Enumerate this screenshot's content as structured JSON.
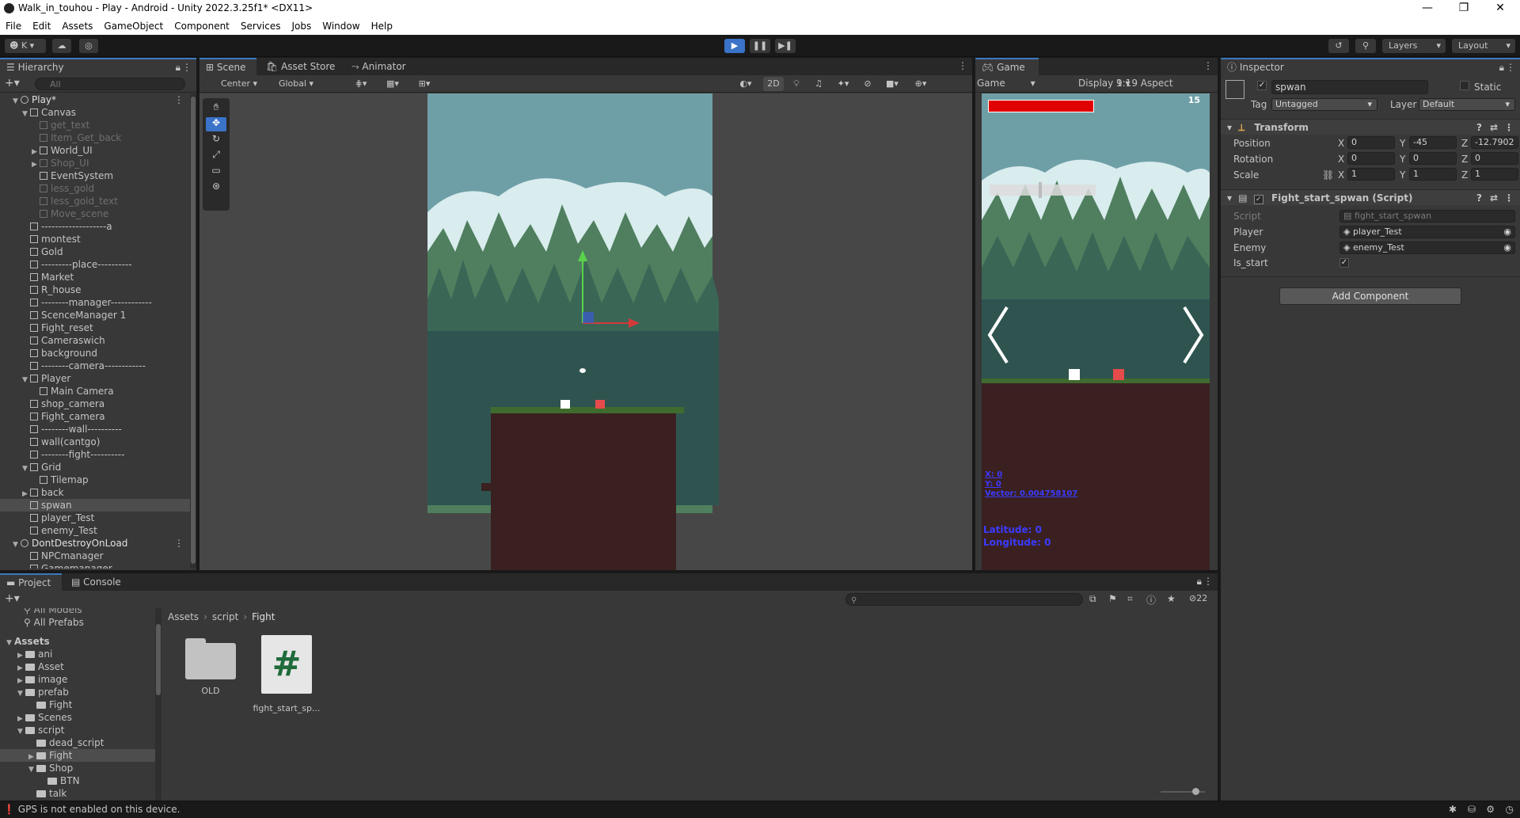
{
  "window": {
    "title": "Walk_in_touhou - Play - Android - Unity 2022.3.25f1* <DX11>",
    "minimize": "—",
    "maximize": "❐",
    "close": "✕"
  },
  "menu": [
    "File",
    "Edit",
    "Assets",
    "GameObject",
    "Component",
    "Services",
    "Jobs",
    "Window",
    "Help"
  ],
  "toolbar": {
    "account": "K",
    "layers": "Layers",
    "layout": "Layout"
  },
  "hierarchy": {
    "tab": "Hierarchy",
    "search_placeholder": "All",
    "items": [
      {
        "label": "Play*",
        "depth": 0,
        "kind": "scene"
      },
      {
        "label": "Canvas",
        "depth": 1
      },
      {
        "label": "get_text",
        "depth": 2,
        "disabled": true
      },
      {
        "label": "Item_Get_back",
        "depth": 2,
        "disabled": true
      },
      {
        "label": "World_UI",
        "depth": 2
      },
      {
        "label": "Shop_UI",
        "depth": 2,
        "disabled": true
      },
      {
        "label": "EventSystem",
        "depth": 2
      },
      {
        "label": "less_gold",
        "depth": 2,
        "disabled": true
      },
      {
        "label": "less_gold_text",
        "depth": 2,
        "disabled": true
      },
      {
        "label": "Move_scene",
        "depth": 2,
        "disabled": true
      },
      {
        "label": "-------------------a",
        "depth": 1
      },
      {
        "label": "montest",
        "depth": 1
      },
      {
        "label": "Gold",
        "depth": 1
      },
      {
        "label": "---------place----------",
        "depth": 1
      },
      {
        "label": "Market",
        "depth": 1
      },
      {
        "label": "R_house",
        "depth": 1
      },
      {
        "label": "--------manager------------",
        "depth": 1
      },
      {
        "label": "ScenceManager 1",
        "depth": 1
      },
      {
        "label": "Fight_reset",
        "depth": 1
      },
      {
        "label": "Cameraswich",
        "depth": 1
      },
      {
        "label": "background",
        "depth": 1
      },
      {
        "label": "--------camera------------",
        "depth": 1
      },
      {
        "label": "Player",
        "depth": 1
      },
      {
        "label": "Main Camera",
        "depth": 2
      },
      {
        "label": "shop_camera",
        "depth": 1
      },
      {
        "label": "Fight_camera",
        "depth": 1
      },
      {
        "label": "--------wall----------",
        "depth": 1
      },
      {
        "label": "wall(cantgo)",
        "depth": 1
      },
      {
        "label": "--------fight----------",
        "depth": 1
      },
      {
        "label": "Grid",
        "depth": 1
      },
      {
        "label": "Tilemap",
        "depth": 2
      },
      {
        "label": "back",
        "depth": 1
      },
      {
        "label": "spwan",
        "depth": 1,
        "selected": true
      },
      {
        "label": "player_Test",
        "depth": 1
      },
      {
        "label": "enemy_Test",
        "depth": 1
      },
      {
        "label": "DontDestroyOnLoad",
        "depth": 0,
        "kind": "scene"
      },
      {
        "label": "NPCmanager",
        "depth": 1
      },
      {
        "label": "Gamemanager",
        "depth": 1
      }
    ]
  },
  "scene": {
    "tabs": [
      "Scene",
      "Asset Store",
      "Animator"
    ],
    "pivot": "Center",
    "space": "Global",
    "mode2d": "2D"
  },
  "game": {
    "tab": "Game",
    "view": "Game",
    "display": "Display 1",
    "aspect": "9:19 Aspect",
    "counter": "15",
    "health_fraction": 1.0,
    "debug_x": "X: 0",
    "debug_y": "Y: 0",
    "debug_vector": "Vector: 0.004758107",
    "latitude": "Latitude: 0",
    "longitude": "Longitude: 0",
    "nav_left": "❮",
    "nav_right": "❯"
  },
  "inspector": {
    "tab": "Inspector",
    "object_name": "spwan",
    "static_label": "Static",
    "tag_label": "Tag",
    "tag_value": "Untagged",
    "layer_label": "Layer",
    "layer_value": "Default",
    "transform": {
      "title": "Transform",
      "rows": [
        {
          "label": "Position",
          "x": "0",
          "y": "-45",
          "z": "-12.7902"
        },
        {
          "label": "Rotation",
          "x": "0",
          "y": "0",
          "z": "0"
        },
        {
          "label": "Scale",
          "x": "1",
          "y": "1",
          "z": "1"
        }
      ]
    },
    "script_component": {
      "title": "Fight_start_spwan (Script)",
      "script_label": "Script",
      "script_value": "fight_start_spwan",
      "player_label": "Player",
      "player_value": "player_Test",
      "enemy_label": "Enemy",
      "enemy_value": "enemy_Test",
      "is_start_label": "Is_start",
      "is_start_checked": true
    },
    "add_component": "Add Component"
  },
  "project": {
    "tabs": [
      "Project",
      "Console"
    ],
    "favorites": [
      "All Models",
      "All Prefabs"
    ],
    "tree": [
      {
        "label": "Assets",
        "depth": 0,
        "bold": true
      },
      {
        "label": "ani",
        "depth": 1
      },
      {
        "label": "Asset",
        "depth": 1
      },
      {
        "label": "image",
        "depth": 1
      },
      {
        "label": "prefab",
        "depth": 1
      },
      {
        "label": "Fight",
        "depth": 2
      },
      {
        "label": "Scenes",
        "depth": 1
      },
      {
        "label": "script",
        "depth": 1
      },
      {
        "label": "dead_script",
        "depth": 2
      },
      {
        "label": "Fight",
        "depth": 2,
        "selected": true
      },
      {
        "label": "Shop",
        "depth": 2
      },
      {
        "label": "BTN",
        "depth": 3
      },
      {
        "label": "talk",
        "depth": 2
      }
    ],
    "breadcrumb": [
      "Assets",
      "script",
      "Fight"
    ],
    "assets": [
      {
        "label": "OLD",
        "kind": "folder"
      },
      {
        "label": "fight_start_sp...",
        "kind": "script"
      }
    ],
    "hidden_count": "22"
  },
  "status": {
    "message": "GPS is not enabled on this device."
  },
  "colors": {
    "accent": "#3a79bb",
    "health": "#e00000",
    "debug_text": "#3b3bff",
    "grass": "#3f6b2e",
    "dirt": "#3a2020"
  }
}
